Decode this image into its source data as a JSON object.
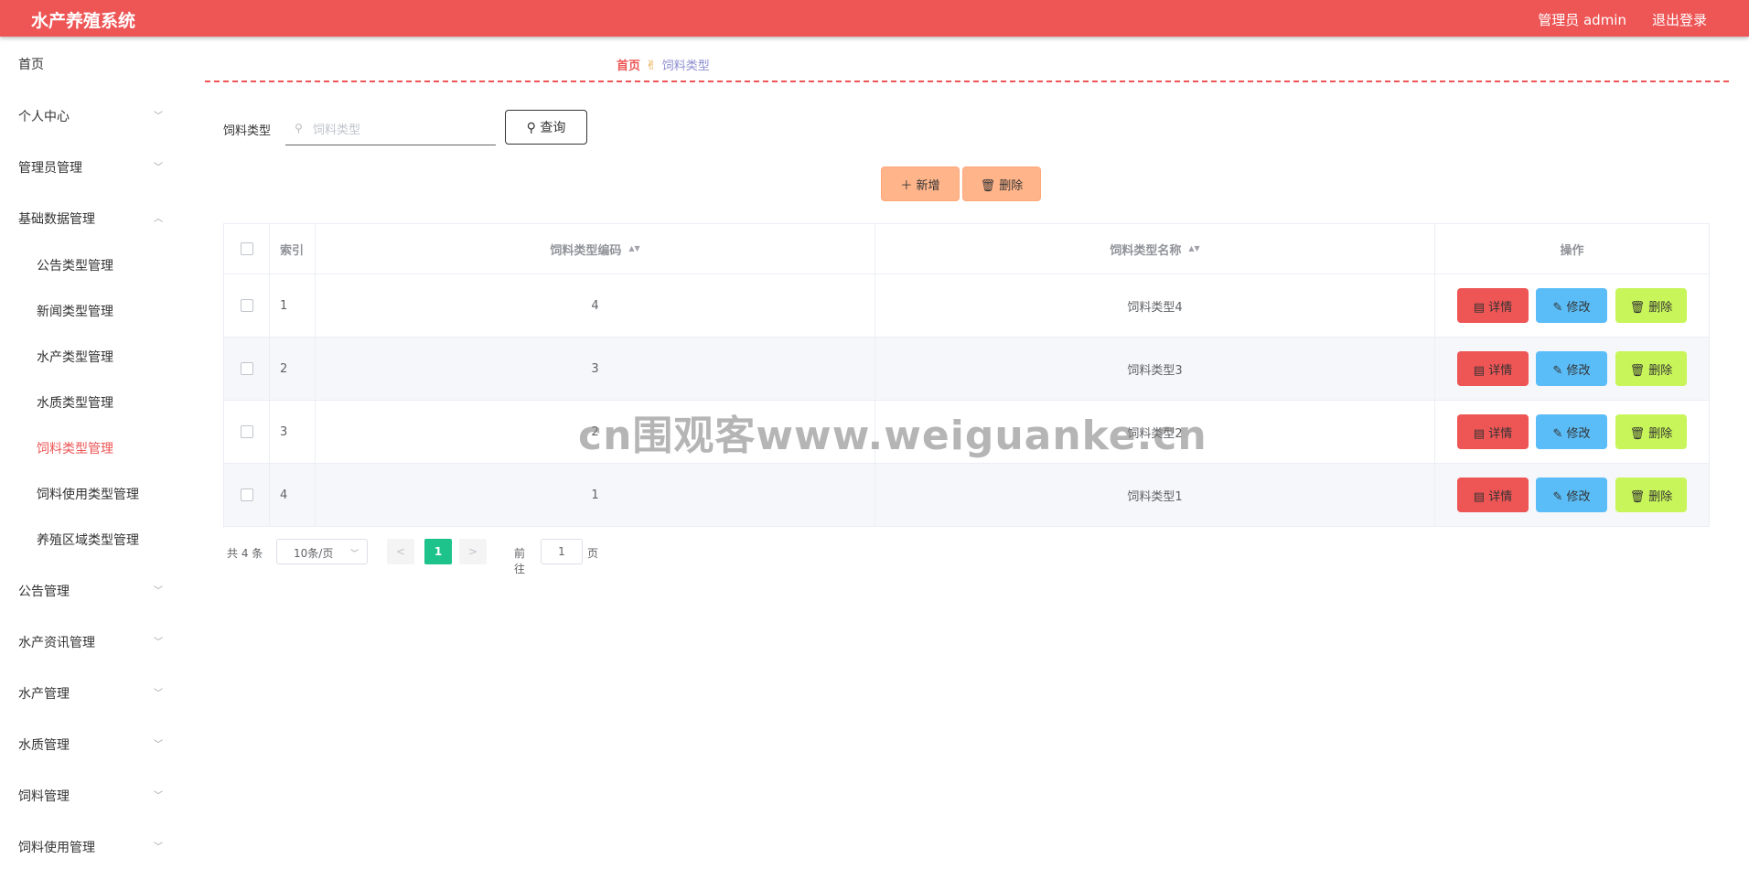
{
  "header": {
    "title": "水产养殖系统",
    "user": "管理员 admin",
    "logout": "退出登录"
  },
  "sidebar": {
    "items": [
      {
        "label": "首页",
        "chevron": ""
      },
      {
        "label": "个人中心",
        "chevron": "﹀"
      },
      {
        "label": "管理员管理",
        "chevron": "﹀"
      },
      {
        "label": "基础数据管理",
        "chevron": "︿"
      },
      {
        "label": "公告类型管理"
      },
      {
        "label": "新闻类型管理"
      },
      {
        "label": "水产类型管理"
      },
      {
        "label": "水质类型管理"
      },
      {
        "label": "饲料类型管理"
      },
      {
        "label": "饲料使用类型管理"
      },
      {
        "label": "养殖区域类型管理"
      },
      {
        "label": "公告管理",
        "chevron": "﹀"
      },
      {
        "label": "水产资讯管理",
        "chevron": "﹀"
      },
      {
        "label": "水产管理",
        "chevron": "﹀"
      },
      {
        "label": "水质管理",
        "chevron": "﹀"
      },
      {
        "label": "饲料管理",
        "chevron": "﹀"
      },
      {
        "label": "饲料使用管理",
        "chevron": "﹀"
      }
    ]
  },
  "breadcrumb": {
    "home": "首页",
    "sep_icon": "✌",
    "current": "饲料类型"
  },
  "search": {
    "label": "饲料类型",
    "placeholder": "饲料类型",
    "icon": "⚲",
    "query_label": "⚲ 查询"
  },
  "actions": {
    "add_label": "＋ 新增",
    "delete_label": "🗑 删除"
  },
  "table": {
    "headers": {
      "index": "索引",
      "code": "饲料类型编码",
      "name": "饲料类型名称",
      "ops": "操作"
    },
    "sort_icon": "▲▼",
    "rows": [
      {
        "index": "1",
        "code": "4",
        "name": "饲料类型4"
      },
      {
        "index": "2",
        "code": "3",
        "name": "饲料类型3"
      },
      {
        "index": "3",
        "code": "2",
        "name": "饲料类型2"
      },
      {
        "index": "4",
        "code": "1",
        "name": "饲料类型1"
      }
    ],
    "row_buttons": {
      "detail": "▤ 详情",
      "edit": "✎ 修改",
      "delete": "🗑 删除"
    }
  },
  "pagination": {
    "total": "共 4 条",
    "page_size": "10条/页",
    "prev": "<",
    "next": ">",
    "current_page": "1",
    "goto_label": "前往",
    "goto_value": "1",
    "page_unit": "页"
  },
  "watermark": "cn围观客www.weiguanke.cn",
  "colors": {
    "accent": "#ee5555",
    "edit": "#5bbdf7",
    "delete": "#c8f55a",
    "action": "#ffb48a",
    "page_active": "#1ec28b"
  }
}
